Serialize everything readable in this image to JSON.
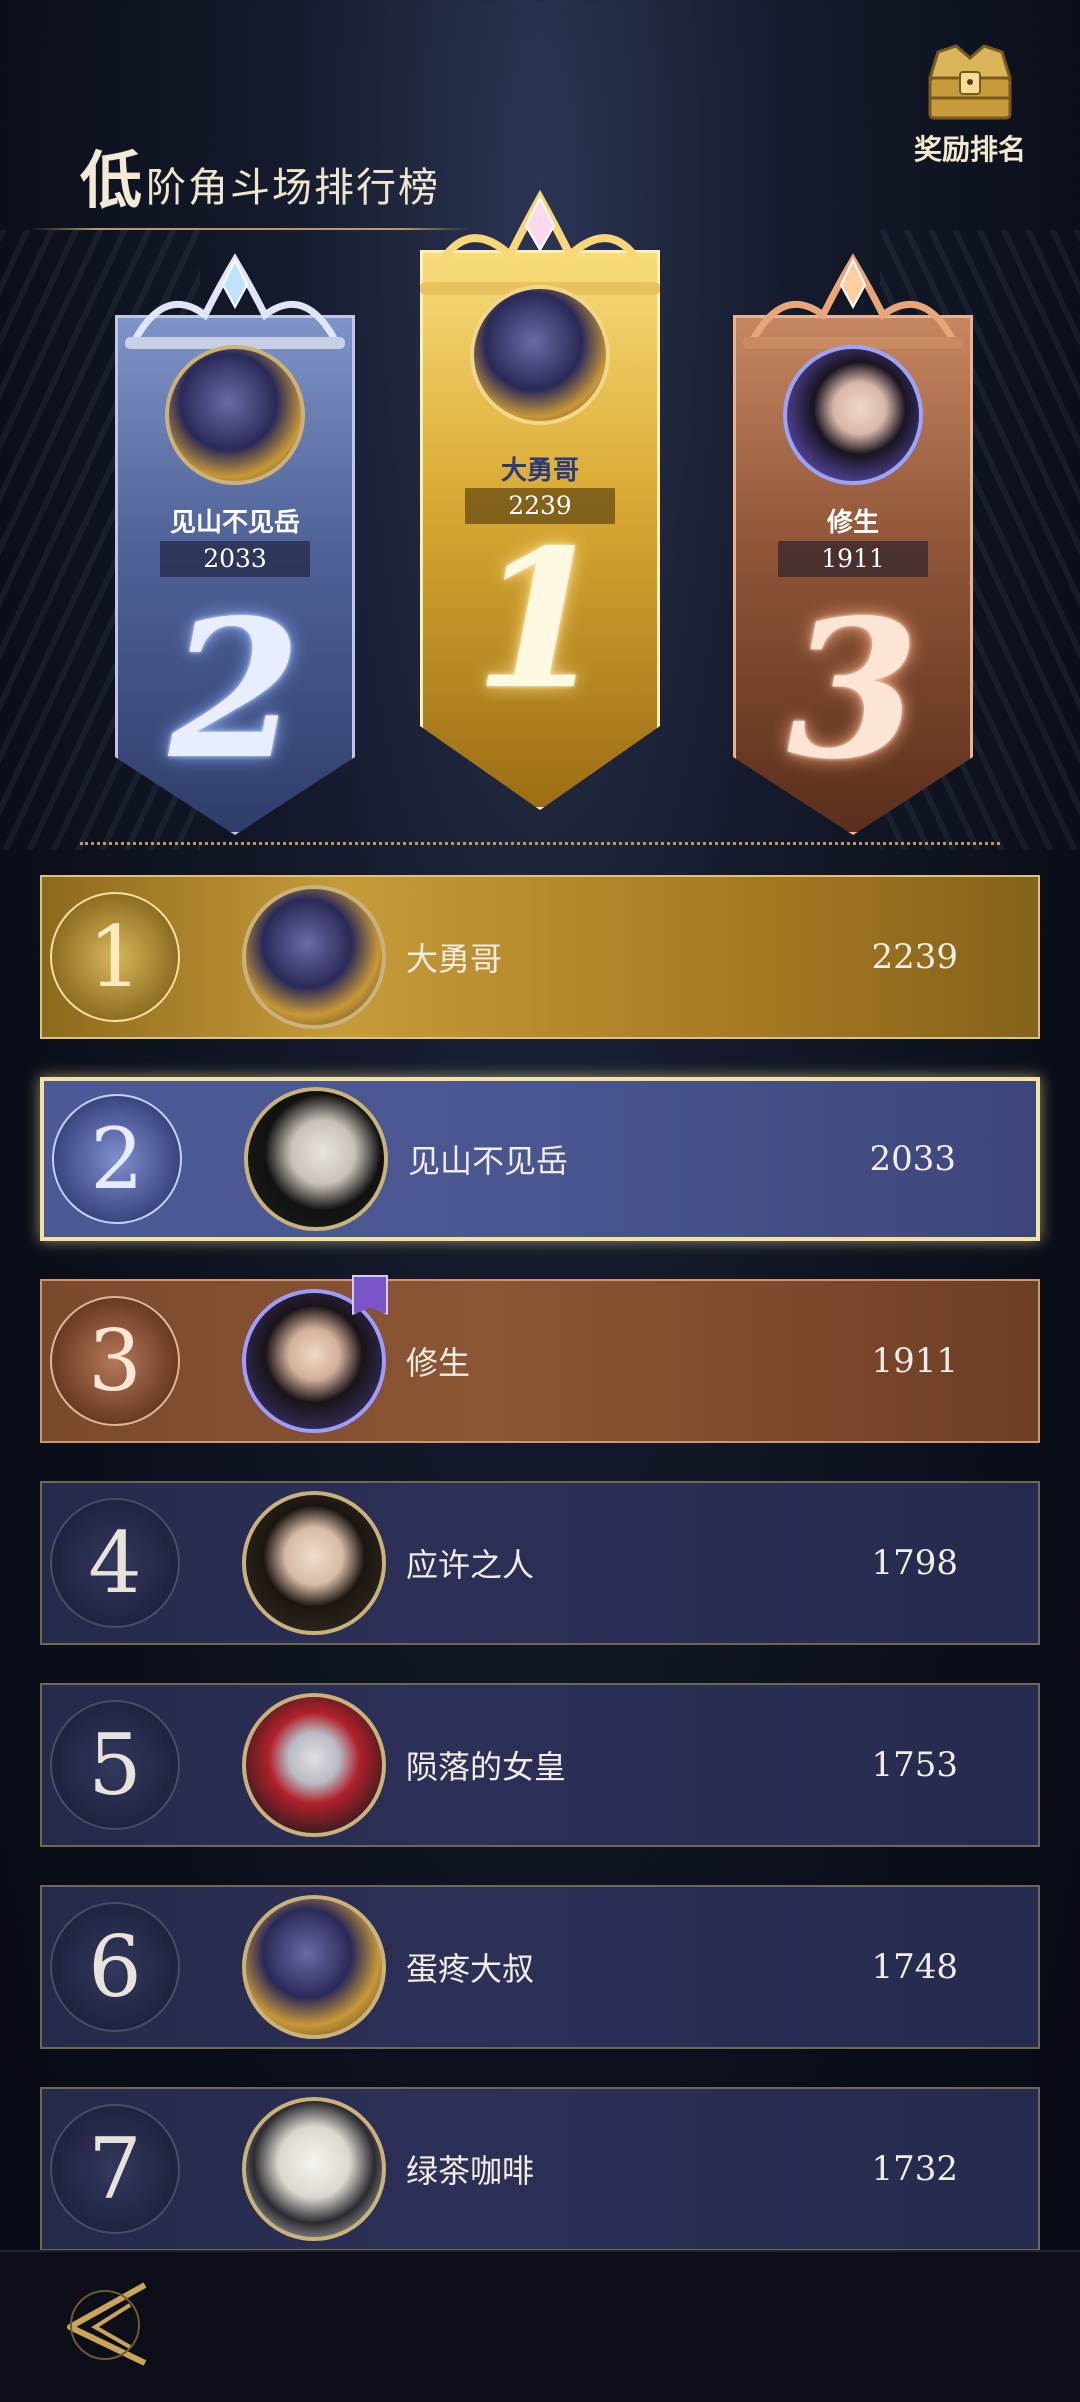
{
  "header": {
    "title_big": "低",
    "title_rest": "阶角斗场排行榜",
    "reward_label": "奖励排名"
  },
  "podium": [
    {
      "rank": "2",
      "name": "见山不见岳",
      "score": "2033"
    },
    {
      "rank": "1",
      "name": "大勇哥",
      "score": "2239"
    },
    {
      "rank": "3",
      "name": "修生",
      "score": "1911"
    }
  ],
  "ranking": [
    {
      "rank": "1",
      "name": "大勇哥",
      "score": "2239"
    },
    {
      "rank": "2",
      "name": "见山不见岳",
      "score": "2033"
    },
    {
      "rank": "3",
      "name": "修生",
      "score": "1911"
    },
    {
      "rank": "4",
      "name": "应许之人",
      "score": "1798"
    },
    {
      "rank": "5",
      "name": "陨落的女皇",
      "score": "1753"
    },
    {
      "rank": "6",
      "name": "蛋疼大叔",
      "score": "1748"
    },
    {
      "rank": "7",
      "name": "绿茶咖啡",
      "score": "1732"
    }
  ],
  "colors": {
    "gold": "#c69b3a",
    "silver": "#4b5a96",
    "bronze": "#8b5634",
    "row": "#2c3057",
    "accent": "#b89a62"
  }
}
